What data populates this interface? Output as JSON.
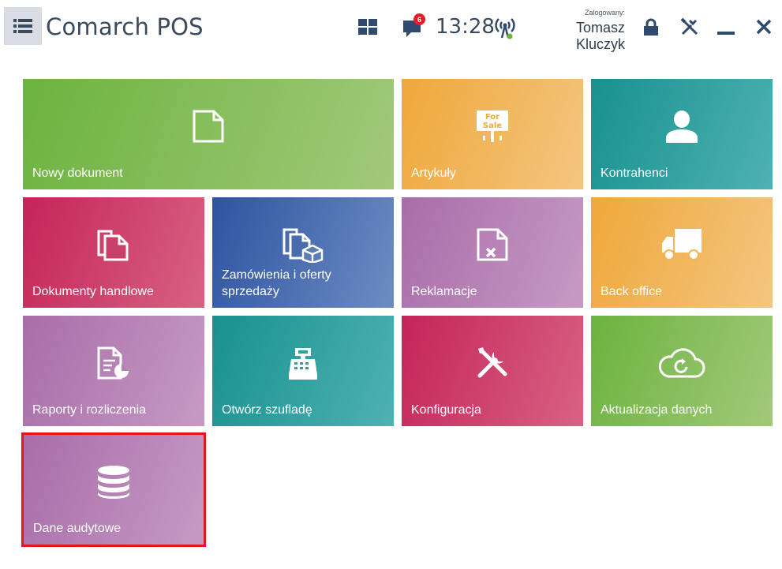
{
  "app": {
    "title": "Comarch POS",
    "time": "13:28",
    "notification_count": "6",
    "login_label": "Zalogowany:",
    "user_name": "Tomasz Kluczyk"
  },
  "toolbar_icons": [
    "menu-icon",
    "tiles-icon",
    "messages-icon",
    "antenna-icon",
    "lock-icon",
    "tools-icon",
    "minimize-icon",
    "close-icon"
  ],
  "tiles": [
    {
      "label": "Nowy dokument",
      "icon": "document-icon",
      "color": "#6cb33f"
    },
    {
      "label": "Artykuły",
      "icon": "for-sale-sign-icon",
      "color": "#efa83a",
      "sign_text": [
        "For",
        "Sale"
      ]
    },
    {
      "label": "Kontrahenci",
      "icon": "person-icon",
      "color": "#17918f"
    },
    {
      "label": "Dokumenty handlowe",
      "icon": "documents-icon",
      "color": "#c5245a"
    },
    {
      "label": "Zamówienia i oferty sprzedaży",
      "icon": "documents-box-icon",
      "color": "#2f54a0"
    },
    {
      "label": "Reklamacje",
      "icon": "document-x-icon",
      "color": "#a86da9"
    },
    {
      "label": "Back office",
      "icon": "truck-icon",
      "color": "#efa83a"
    },
    {
      "label": "Raporty i rozliczenia",
      "icon": "report-icon",
      "color": "#a86da9"
    },
    {
      "label": "Otwórz szufladę",
      "icon": "cash-register-icon",
      "color": "#17918f"
    },
    {
      "label": "Konfiguracja",
      "icon": "tools-icon",
      "color": "#c5245a"
    },
    {
      "label": "Aktualizacja danych",
      "icon": "cloud-refresh-icon",
      "color": "#6cb33f"
    },
    {
      "label": "Dane audytowe",
      "icon": "database-icon",
      "color": "#a86da9",
      "selected": true
    }
  ]
}
